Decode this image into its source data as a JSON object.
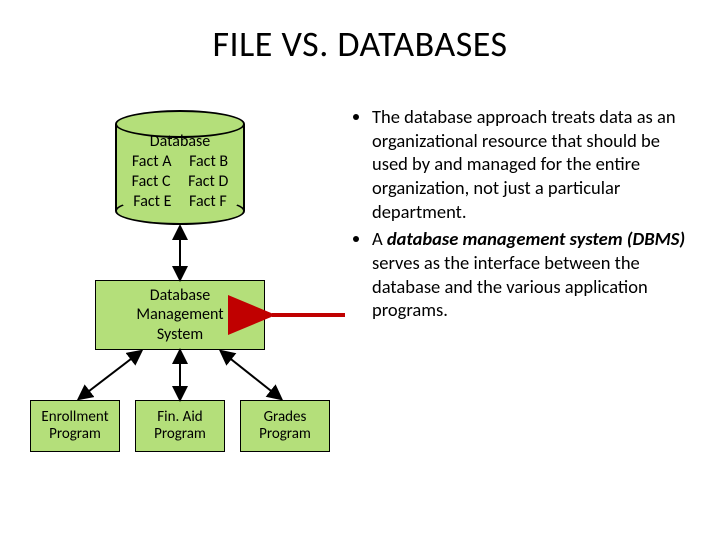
{
  "title": "FILE VS. DATABASES",
  "cylinder": {
    "label": "Database",
    "facts": [
      "Fact A",
      "Fact B",
      "Fact C",
      "Fact D",
      "Fact E",
      "Fact F"
    ]
  },
  "dbms": {
    "line1": "Database",
    "line2": "Management",
    "line3": "System"
  },
  "apps": [
    {
      "line1": "Enrollment",
      "line2": "Program"
    },
    {
      "line1": "Fin. Aid",
      "line2": "Program"
    },
    {
      "line1": "Grades",
      "line2": "Program"
    }
  ],
  "bullets": [
    {
      "plain": "The database approach treats data as an organizational resource that should be used by and managed for the entire organization, not just a particular department."
    },
    {
      "pre": "A ",
      "bold_italic": "database management system (DBMS) ",
      "post": "serves as the interface between the database and the various application programs."
    }
  ],
  "arrow_color": "#c00000",
  "chart_data": {
    "type": "diagram",
    "nodes": [
      {
        "id": "db",
        "label": "Database",
        "shape": "cylinder",
        "contents": [
          "Fact A",
          "Fact B",
          "Fact C",
          "Fact D",
          "Fact E",
          "Fact F"
        ]
      },
      {
        "id": "dbms",
        "label": "Database Management System",
        "shape": "rect"
      },
      {
        "id": "enr",
        "label": "Enrollment Program",
        "shape": "rect"
      },
      {
        "id": "fin",
        "label": "Fin. Aid Program",
        "shape": "rect"
      },
      {
        "id": "grd",
        "label": "Grades Program",
        "shape": "rect"
      }
    ],
    "edges": [
      {
        "from": "db",
        "to": "dbms",
        "dir": "bidirectional"
      },
      {
        "from": "dbms",
        "to": "enr",
        "dir": "bidirectional"
      },
      {
        "from": "dbms",
        "to": "fin",
        "dir": "bidirectional"
      },
      {
        "from": "dbms",
        "to": "grd",
        "dir": "bidirectional"
      }
    ],
    "callout": {
      "target": "dbms",
      "style": "red-arrow-from-right"
    }
  }
}
